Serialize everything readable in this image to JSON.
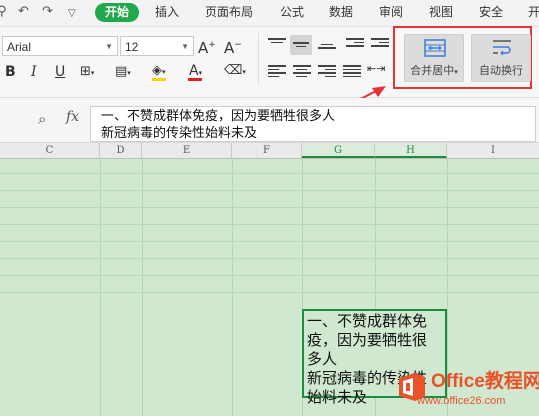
{
  "menubar": {
    "tabs": [
      "开始",
      "插入",
      "页面布局",
      "公式",
      "数据",
      "审阅",
      "视图",
      "安全",
      "开"
    ]
  },
  "font": {
    "name": "Arial",
    "size": "12"
  },
  "ribbon": {
    "merge_label": "合并居中",
    "wrap_label": "自动换行"
  },
  "formula": {
    "fx": "fx",
    "line1": "一、不赞成群体免疫，因为要牺牲很多人",
    "line2": "新冠病毒的传染性始料未及"
  },
  "columns": [
    "C",
    "D",
    "E",
    "F",
    "G",
    "H",
    "I"
  ],
  "cell": {
    "lines": [
      "一、不赞成群体免",
      "疫，因为要牺牲很",
      "多人",
      "新冠病毒的传染性",
      "始料未及"
    ]
  },
  "watermark": {
    "brand": "Office教程网",
    "url": "www.office26.com"
  }
}
